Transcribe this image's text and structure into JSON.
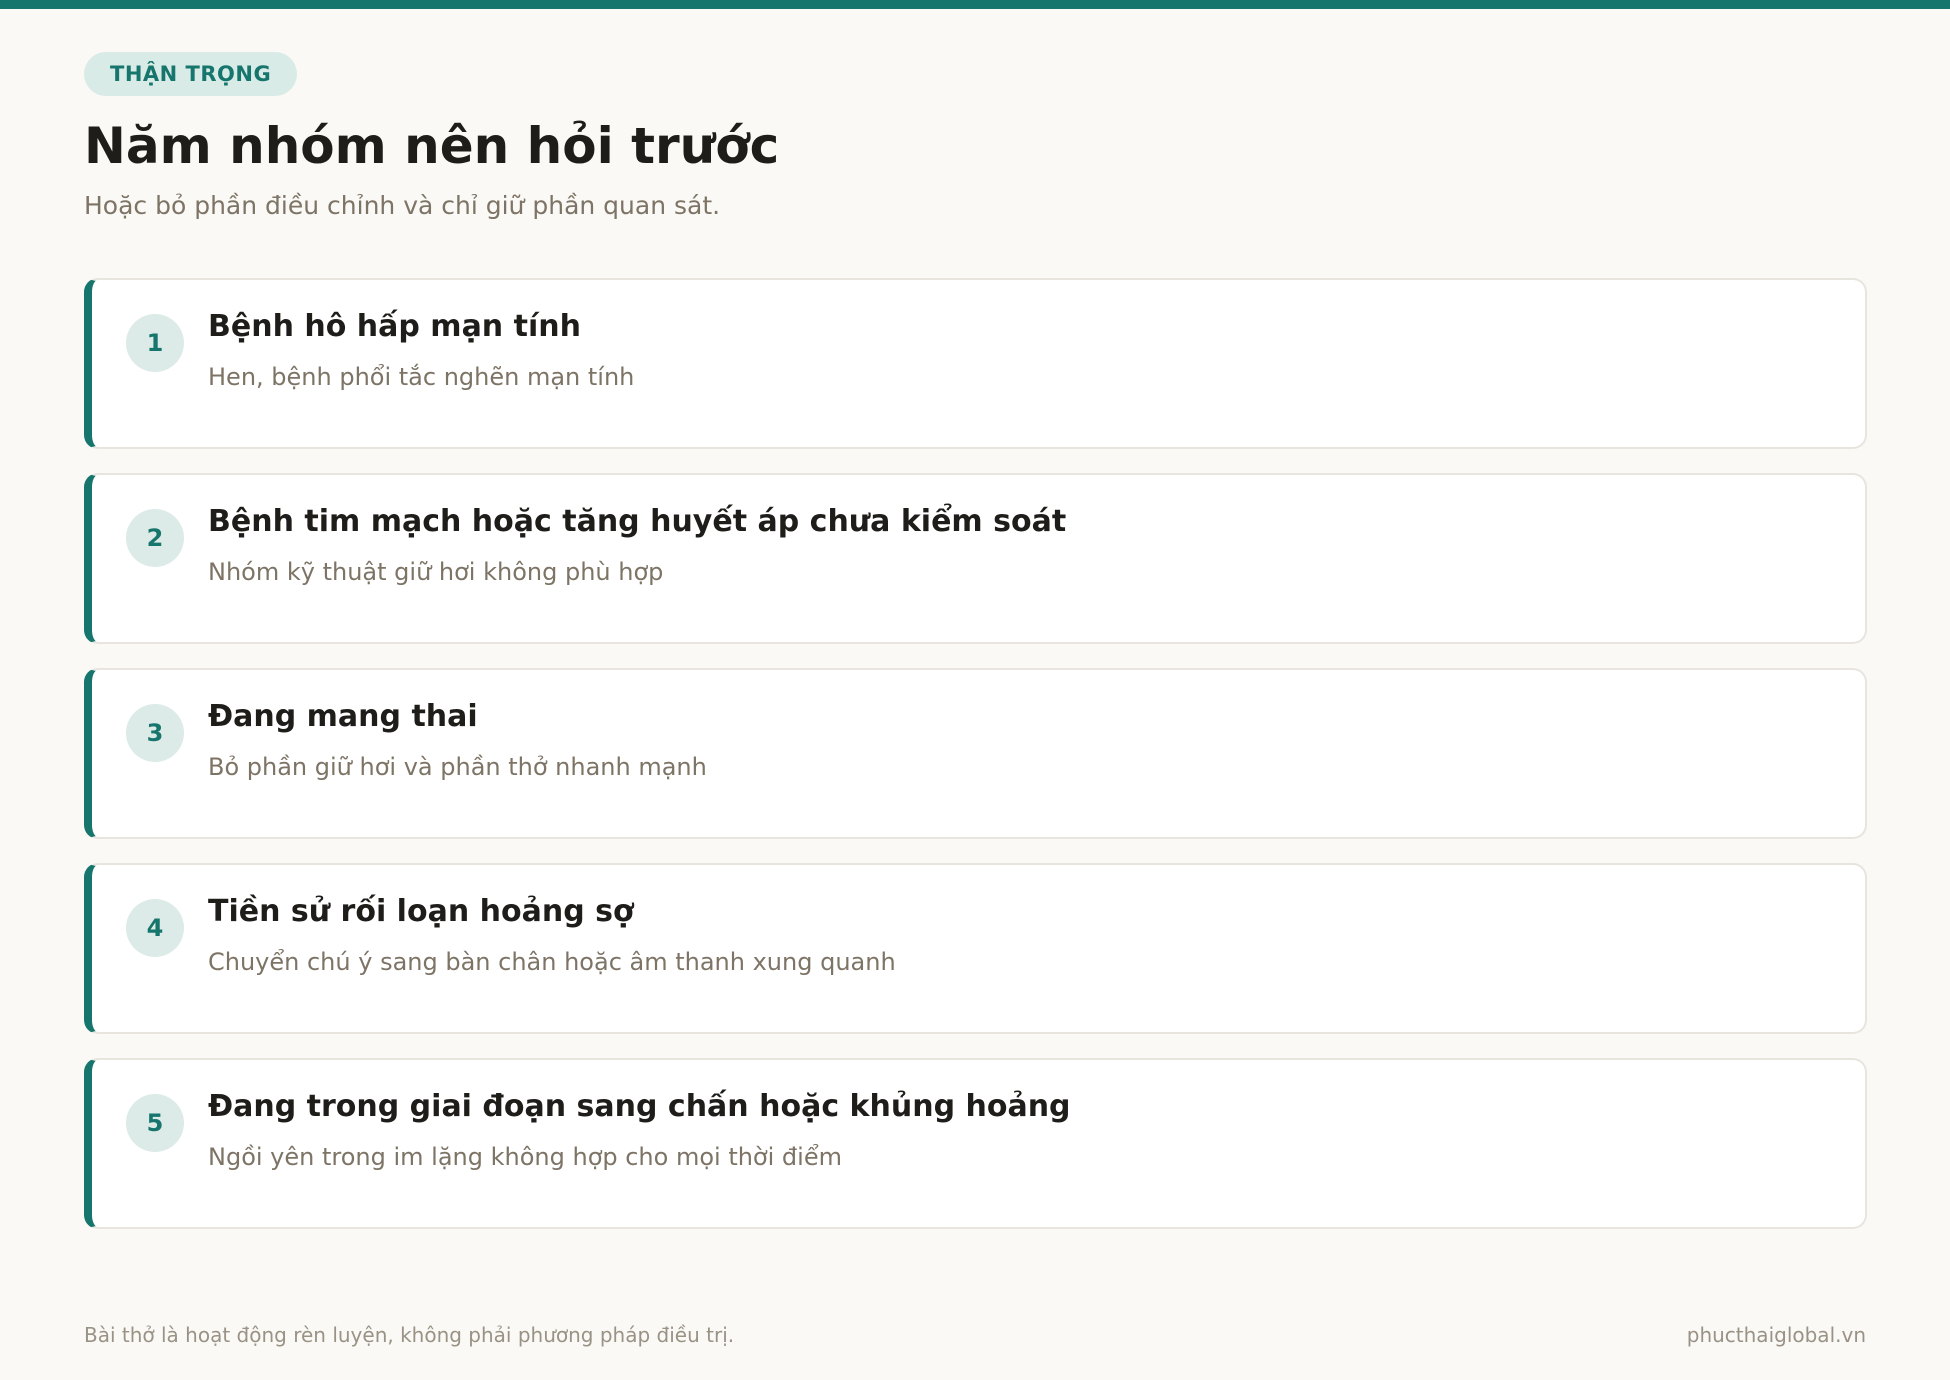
{
  "header": {
    "badge": "THẬN TRỌNG",
    "title": "Năm nhóm nên hỏi trước",
    "subtitle": "Hoặc bỏ phần điều chỉnh và chỉ giữ phần quan sát."
  },
  "items": [
    {
      "number": "1",
      "title": "Bệnh hô hấp mạn tính",
      "desc": "Hen, bệnh phổi tắc nghẽn mạn tính"
    },
    {
      "number": "2",
      "title": "Bệnh tim mạch hoặc tăng huyết áp chưa kiểm soát",
      "desc": "Nhóm kỹ thuật giữ hơi không phù hợp"
    },
    {
      "number": "3",
      "title": "Đang mang thai",
      "desc": "Bỏ phần giữ hơi và phần thở nhanh mạnh"
    },
    {
      "number": "4",
      "title": "Tiền sử rối loạn hoảng sợ",
      "desc": "Chuyển chú ý sang bàn chân hoặc âm thanh xung quanh"
    },
    {
      "number": "5",
      "title": "Đang trong giai đoạn sang chấn hoặc khủng hoảng",
      "desc": "Ngồi yên trong im lặng không hợp cho mọi thời điểm"
    }
  ],
  "footer": {
    "note": "Bài thở là hoạt động rèn luyện, không phải phương pháp điều trị.",
    "site": "phucthaiglobal.vn"
  },
  "colors": {
    "accent": "#16756c",
    "badge_bg": "#d9ebe7",
    "background": "#faf9f6",
    "muted_text": "#7d7466"
  }
}
